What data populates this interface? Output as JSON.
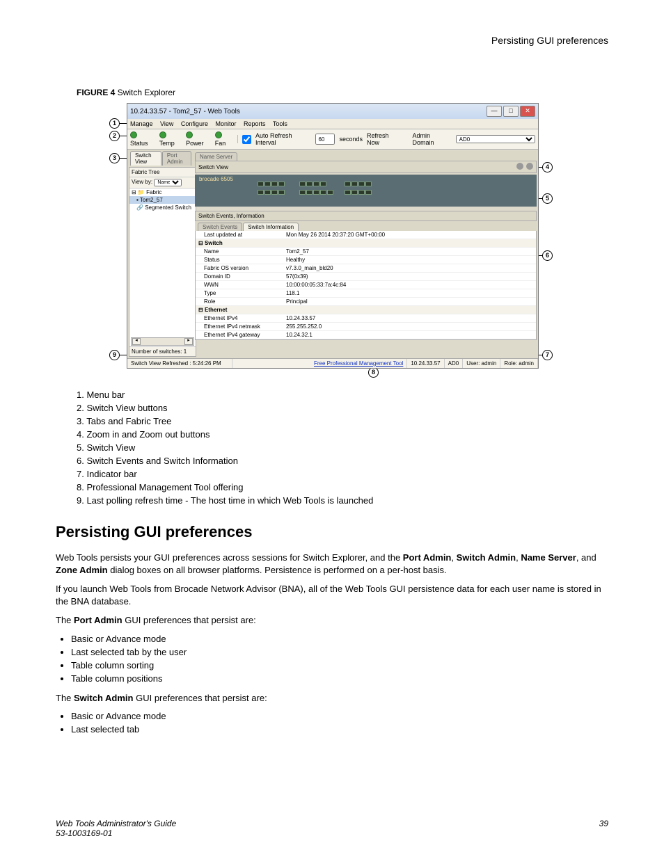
{
  "page": {
    "top_header": "Persisting GUI preferences",
    "figure_caption_bold": "FIGURE 4",
    "figure_caption_text": " Switch Explorer"
  },
  "screenshot": {
    "title": "10.24.33.57 - Tom2_57 - Web Tools",
    "menubar": {
      "m0": "Manage",
      "m1": "View",
      "m2": "Configure",
      "m3": "Monitor",
      "m4": "Reports",
      "m5": "Tools"
    },
    "toolbar": {
      "status": "Status",
      "temp": "Temp",
      "power": "Power",
      "fan": "Fan",
      "autorefresh": "Auto Refresh Interval",
      "interval": "60",
      "seconds": "seconds",
      "refresh": "Refresh Now",
      "admindomain_label": "Admin Domain",
      "admindomain": "AD0"
    },
    "left_tabs": {
      "t0": "Switch View",
      "t1": "Port Admin",
      "t2": "Name Server"
    },
    "fabric_tree": {
      "header": "Fabric Tree",
      "viewby": "View by:",
      "viewby_val": "Name",
      "root": "Fabric",
      "node1": "Tom2_57",
      "node2": "Segmented Switch",
      "num_sw": "Number of switches:  1"
    },
    "right": {
      "sv_header": "Switch View",
      "device_label": "brocade 6505",
      "se_header": "Switch Events, Information",
      "tabs": {
        "t0": "Switch Events",
        "t1": "Switch Information"
      },
      "rows": {
        "last_updated_k": "Last updated at",
        "last_updated_v": "Mon May 26 2014 20:37:20 GMT+00:00",
        "switch_section": "Switch",
        "name_k": "Name",
        "name_v": "Tom2_57",
        "status_k": "Status",
        "status_v": "Healthy",
        "fos_k": "Fabric OS version",
        "fos_v": "v7.3.0_main_bld20",
        "domain_k": "Domain ID",
        "domain_v": "57(0x39)",
        "wwn_k": "WWN",
        "wwn_v": "10:00:00:05:33:7a:4c:84",
        "type_k": "Type",
        "type_v": "118.1",
        "role_k": "Role",
        "role_v": "Principal",
        "eth_section": "Ethernet",
        "ipv4_k": "Ethernet IPv4",
        "ipv4_v": "10.24.33.57",
        "netmask_k": "Ethernet IPv4 netmask",
        "netmask_v": "255.255.252.0",
        "gateway_k": "Ethernet IPv4 gateway",
        "gateway_v": "10.24.32.1"
      }
    },
    "statusbar": {
      "left": "Switch View Refreshed : 5:24:26 PM",
      "link": "Free Professional Management Tool",
      "ip": "10.24.33.57",
      "ad": "AD0",
      "user": "User: admin",
      "role": "Role: admin"
    }
  },
  "callouts": {
    "c1": "1",
    "c2": "2",
    "c3": "3",
    "c4": "4",
    "c5": "5",
    "c6": "6",
    "c7": "7",
    "c8": "8",
    "c9": "9"
  },
  "legend": {
    "l1": "1.  Menu bar",
    "l2": "2.  Switch View buttons",
    "l3": "3.  Tabs and Fabric Tree",
    "l4": "4.  Zoom in and Zoom out buttons",
    "l5": "5.  Switch View",
    "l6": "6.  Switch Events and Switch Information",
    "l7": "7.  Indicator bar",
    "l8": "8.  Professional Management Tool offering",
    "l9": "9.  Last polling refresh time - The host time in which Web Tools is launched"
  },
  "doc": {
    "heading": "Persisting GUI preferences",
    "p1_pre": "Web Tools persists your GUI preferences across sessions for Switch Explorer, and the ",
    "p1_b1": "Port Admin",
    "p1_mid1": ", ",
    "p1_b2": "Switch Admin",
    "p1_mid2": ", ",
    "p1_b3": "Name Server",
    "p1_mid3": ", and ",
    "p1_b4": "Zone Admin",
    "p1_post": " dialog boxes on all browser platforms. Persistence is performed on a per-host basis.",
    "p2": "If you launch Web Tools from Brocade Network Advisor (BNA), all of the Web Tools GUI persistence data for each user name is stored in the BNA database.",
    "p3_pre": "The ",
    "p3_b": "Port Admin",
    "p3_post": " GUI preferences that persist are:",
    "pa_b1": "Basic or Advance mode",
    "pa_b2": "Last selected tab by the user",
    "pa_b3": "Table column sorting",
    "pa_b4": "Table column positions",
    "p4_pre": "The ",
    "p4_b": "Switch Admin",
    "p4_post": " GUI preferences that persist are:",
    "sa_b1": "Basic or Advance mode",
    "sa_b2": "Last selected tab"
  },
  "footer": {
    "left1": "Web Tools Administrator's Guide",
    "left2": "53-1003169-01",
    "right": "39"
  }
}
